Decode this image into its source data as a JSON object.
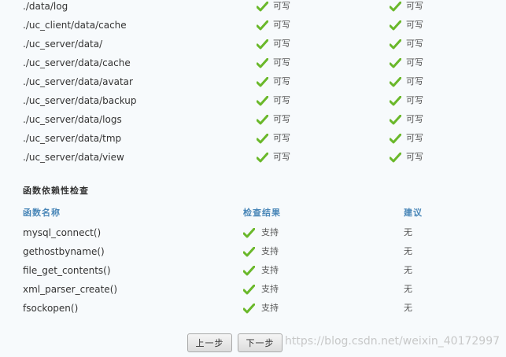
{
  "directories": [
    {
      "path": "./data/log",
      "status1": "可写",
      "status2": "可写"
    },
    {
      "path": "./uc_client/data/cache",
      "status1": "可写",
      "status2": "可写"
    },
    {
      "path": "./uc_server/data/",
      "status1": "可写",
      "status2": "可写"
    },
    {
      "path": "./uc_server/data/cache",
      "status1": "可写",
      "status2": "可写"
    },
    {
      "path": "./uc_server/data/avatar",
      "status1": "可写",
      "status2": "可写"
    },
    {
      "path": "./uc_server/data/backup",
      "status1": "可写",
      "status2": "可写"
    },
    {
      "path": "./uc_server/data/logs",
      "status1": "可写",
      "status2": "可写"
    },
    {
      "path": "./uc_server/data/tmp",
      "status1": "可写",
      "status2": "可写"
    },
    {
      "path": "./uc_server/data/view",
      "status1": "可写",
      "status2": "可写"
    }
  ],
  "func_section": {
    "title": "函数依赖性检查",
    "headers": {
      "name": "函数名称",
      "result": "检查结果",
      "advice": "建议"
    },
    "rows": [
      {
        "name": "mysql_connect()",
        "result": "支持",
        "advice": "无"
      },
      {
        "name": "gethostbyname()",
        "result": "支持",
        "advice": "无"
      },
      {
        "name": "file_get_contents()",
        "result": "支持",
        "advice": "无"
      },
      {
        "name": "xml_parser_create()",
        "result": "支持",
        "advice": "无"
      },
      {
        "name": "fsockopen()",
        "result": "支持",
        "advice": "无"
      }
    ]
  },
  "buttons": {
    "prev": "上一步",
    "next": "下一步"
  },
  "watermark": "https://blog.csdn.net/weixin_40172997",
  "icons": {
    "check": "check-icon"
  },
  "colors": {
    "check_green": "#6ab82a",
    "header_blue": "#4a87b8"
  }
}
